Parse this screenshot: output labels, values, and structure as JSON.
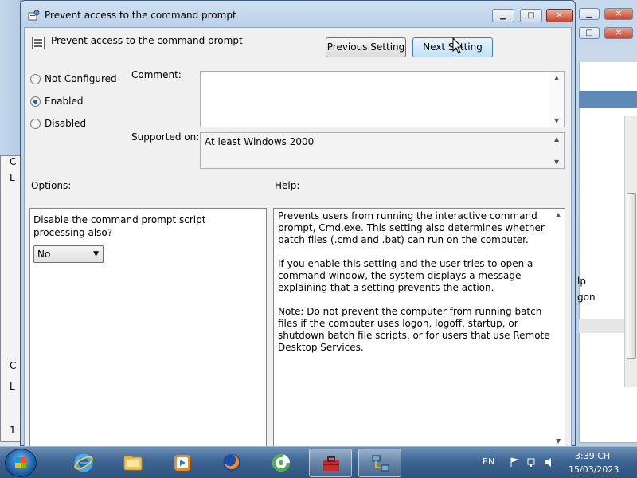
{
  "dialog": {
    "title": "Prevent access to the command prompt",
    "setting_name": "Prevent access to the command prompt",
    "buttons": {
      "minimize": "▁",
      "maximize": "□",
      "close": "✕",
      "previous": "Previous Setting",
      "next": "Next Setting"
    },
    "state_options": [
      {
        "label": "Not Configured",
        "selected": false
      },
      {
        "label": "Enabled",
        "selected": true
      },
      {
        "label": "Disabled",
        "selected": false
      }
    ],
    "comment_label": "Comment:",
    "comment_value": "",
    "supported_label": "Supported on:",
    "supported_value": "At least Windows 2000",
    "options_label": "Options:",
    "help_label": "Help:",
    "option_question": "Disable the command prompt script processing also?",
    "option_value": "No",
    "help_paragraphs": [
      "Prevents users from running the interactive command prompt, Cmd.exe. This setting also determines whether batch files (.cmd and .bat) can run on the computer.",
      "If you enable this setting and the user tries to open a command window, the system displays a message explaining that a setting prevents the action.",
      "Note: Do not prevent the computer from running batch files if the computer uses logon, logoff, startup, or shutdown batch file scripts, or for users that use Remote Desktop Services."
    ]
  },
  "background_right": {
    "text_1": "lp",
    "text_2": "gon"
  },
  "background_left": {
    "chars": [
      "C",
      "L",
      "C",
      "L",
      "1"
    ]
  },
  "taskbar": {
    "language": "EN",
    "time": "3:39 CH",
    "date": "15/03/2023",
    "apps": [
      "start-icon",
      "ie-icon",
      "explorer-icon",
      "media-player-icon",
      "firefox-icon",
      "coccoc-icon",
      "toolbox-icon",
      "network-icon"
    ]
  },
  "colors": {
    "titlebar": "#bcd2ea",
    "accent": "#3c7fb1",
    "taskbar": "#3d6591"
  }
}
